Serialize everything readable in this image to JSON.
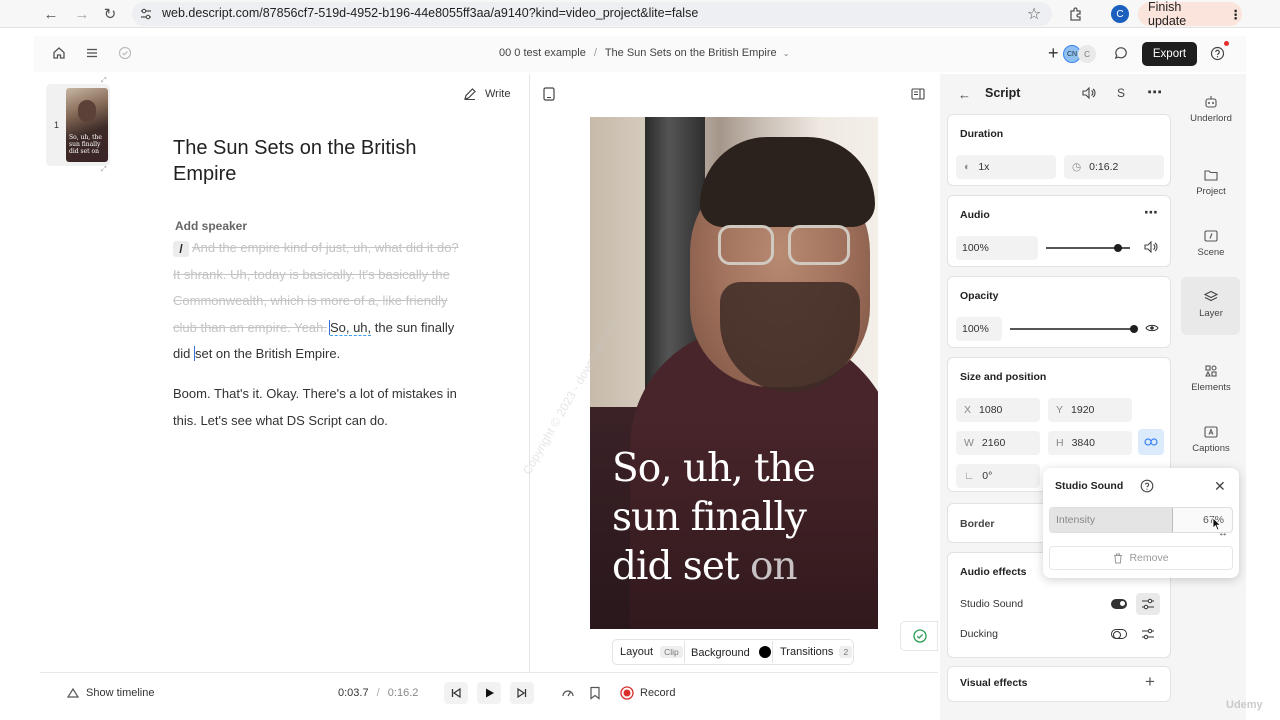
{
  "browser": {
    "url": "web.descript.com/87856cf7-519d-4952-b196-44e8055ff3aa/a9140?kind=video_project&lite=false",
    "profile_initial": "C",
    "finish_update_label": "Finish update"
  },
  "header": {
    "breadcrumb_project": "00 0 test example",
    "breadcrumb_sep": "/",
    "breadcrumb_doc": "The Sun Sets on the British Empire",
    "collab_initials": [
      "CN",
      "C"
    ],
    "export_label": "Export"
  },
  "doc": {
    "scene_number": "1",
    "thumb_caption": "So, uh, the sun finally did set on",
    "write_label": "Write",
    "title_line1": "The Sun Sets on the British",
    "title_line2": "Empire",
    "add_speaker": "Add speaker",
    "slash": "/",
    "struck_1": "And the empire kind of just, uh, what did it do?",
    "struck_2": "It shrank. Uh, today is basically. It's basically the",
    "struck_3": "Commonwealth, which is more of a, like friendly",
    "struck_4": "club than an empire. Yeah.",
    "kept_1a": "So, uh,",
    "kept_1b": " the sun finally",
    "kept_2a": "did ",
    "kept_2b": "set on the British Empire.",
    "para2_line1": "Boom. That's it. Okay. There's a lot of mistakes in",
    "para2_line2": "this. Let's see what DS Script can do."
  },
  "preview": {
    "caption_words": [
      "So, uh, the",
      "sun finally",
      "did set"
    ],
    "caption_dim_word": "on",
    "layout_label": "Layout",
    "layout_badge": "Clip",
    "background_label": "Background",
    "transitions_label": "Transitions",
    "transitions_count": "2",
    "watermark": "Copyright © 2023 - download.com"
  },
  "bottom": {
    "show_timeline": "Show timeline",
    "current_time": "0:03.7",
    "time_sep": "/",
    "total_time": "0:16.2",
    "record_label": "Record"
  },
  "right_panel": {
    "title": "Script",
    "s_label": "S",
    "duration": {
      "title": "Duration",
      "speed": "1x",
      "length": "0:16.2"
    },
    "audio": {
      "title": "Audio",
      "volume": "100%",
      "volume_fraction": 0.86
    },
    "opacity": {
      "title": "Opacity",
      "value": "100%",
      "value_fraction": 1.0
    },
    "size_position": {
      "title": "Size and position",
      "x_label": "X",
      "x": "1080",
      "y_label": "Y",
      "y": "1920",
      "w_label": "W",
      "w": "2160",
      "h_label": "H",
      "h": "3840",
      "rotation": "0°"
    },
    "border_title": "Border",
    "audio_effects": {
      "title": "Audio effects",
      "studio_sound": "Studio Sound",
      "ducking": "Ducking"
    },
    "visual_effects": "Visual effects"
  },
  "popover": {
    "title": "Studio Sound",
    "intensity_label": "Intensity",
    "intensity_value": "67%",
    "intensity_fraction": 0.67,
    "remove_label": "Remove"
  },
  "sidebar": {
    "items": [
      {
        "label": "Underlord",
        "icon": "underlord-icon"
      },
      {
        "label": "Project",
        "icon": "folder-icon"
      },
      {
        "label": "Scene",
        "icon": "scene-icon"
      },
      {
        "label": "Layer",
        "icon": "layers-icon"
      },
      {
        "label": "Elements",
        "icon": "elements-icon"
      },
      {
        "label": "Captions",
        "icon": "captions-icon"
      }
    ]
  },
  "udemy_watermark": "Udemy"
}
